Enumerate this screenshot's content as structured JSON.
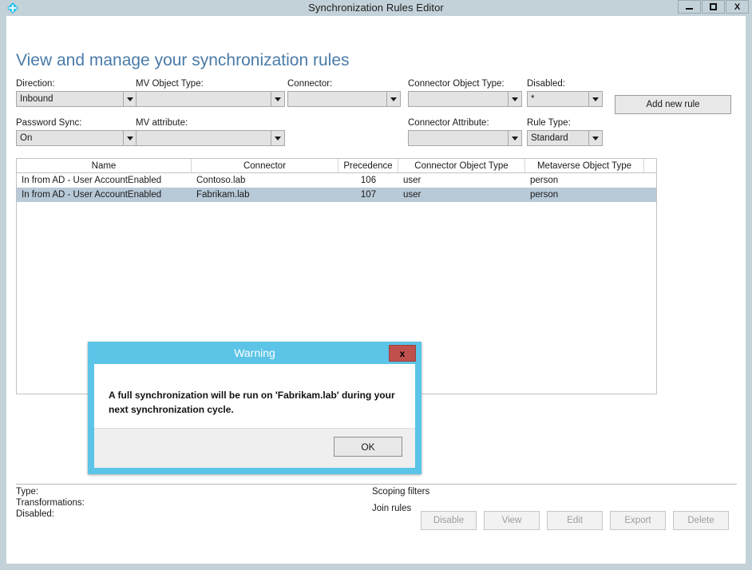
{
  "window": {
    "title": "Synchronization Rules Editor",
    "icon": "sync-diamond-icon",
    "minimize_label": "–",
    "maximize_label": "□",
    "close_label": "X"
  },
  "page": {
    "heading": "View and manage your synchronization rules"
  },
  "filters": {
    "direction": {
      "label": "Direction:",
      "value": "Inbound"
    },
    "mv_object_type": {
      "label": "MV Object Type:",
      "value": ""
    },
    "connector": {
      "label": "Connector:",
      "value": ""
    },
    "connector_object_type": {
      "label": "Connector Object Type:",
      "value": ""
    },
    "disabled": {
      "label": "Disabled:",
      "value": "*"
    },
    "password_sync": {
      "label": "Password Sync:",
      "value": "On"
    },
    "mv_attribute": {
      "label": "MV attribute:",
      "value": ""
    },
    "connector_attribute": {
      "label": "Connector Attribute:",
      "value": ""
    },
    "rule_type": {
      "label": "Rule Type:",
      "value": "Standard"
    },
    "add_new_rule": "Add new rule"
  },
  "grid": {
    "columns": [
      "Name",
      "Connector",
      "Precedence",
      "Connector Object Type",
      "Metaverse Object Type"
    ],
    "rows": [
      {
        "name": "In from AD - User AccountEnabled",
        "connector": "Contoso.lab",
        "precedence": "106",
        "connector_object_type": "user",
        "metaverse_object_type": "person",
        "selected": false
      },
      {
        "name": "In from AD - User AccountEnabled",
        "connector": "Fabrikam.lab",
        "precedence": "107",
        "connector_object_type": "user",
        "metaverse_object_type": "person",
        "selected": true
      }
    ]
  },
  "details": {
    "type_label": "Type:",
    "transformations_label": "Transformations:",
    "disabled_label": "Disabled:",
    "scoping_filters_label": "Scoping filters",
    "join_rules_label": "Join rules"
  },
  "actions": {
    "disable": "Disable",
    "view": "View",
    "edit": "Edit",
    "export": "Export",
    "delete": "Delete"
  },
  "dialog": {
    "title": "Warning",
    "close_label": "x",
    "message": "A full synchronization will be run on 'Fabrikam.lab' during your next synchronization cycle.",
    "ok_label": "OK"
  },
  "colors": {
    "titlebar": "#c3d2d8",
    "heading": "#4a7ba8",
    "dialog_header": "#5bc4e7",
    "close_button": "#c0504d",
    "row_selected": "#b8c9d7"
  }
}
